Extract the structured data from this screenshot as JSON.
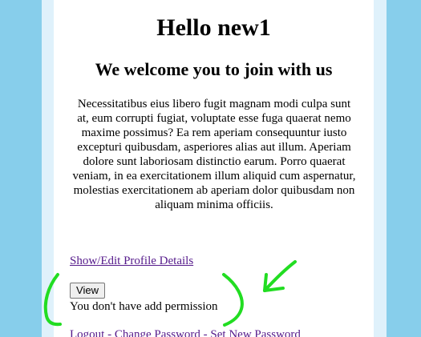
{
  "page": {
    "title": "Hello new1",
    "subtitle": "We welcome you to join with us",
    "intro": "Necessitatibus eius libero fugit magnam modi culpa sunt at, eum corrupti fugiat, voluptate esse fuga quaerat nemo maxime possimus? Ea rem aperiam consequuntur iusto excepturi quibusdam, asperiores alias aut illum. Aperiam dolore sunt laboriosam distinctio earum. Porro quaerat veniam, in ea exercitationem illum aliquid cum aspernatur, molestias exercitationem ab aperiam dolor quibusdam non aliquam minima officiis."
  },
  "profile": {
    "link_label": "Show/Edit Profile Details"
  },
  "actions": {
    "view_label": "View",
    "permission_message": "You don't have add permission"
  },
  "footer": {
    "logout": "Logout",
    "separator": " - ",
    "change_password": "Change Password",
    "set_new_password": "Set New Password"
  },
  "colors": {
    "page_background": "#87ceeb",
    "annotation": "#22dd22",
    "link": "#551a8b"
  },
  "annotations": {
    "arrow_icon": "arrow-icon",
    "bracket_icons": [
      "left-bracket-icon",
      "right-bracket-icon"
    ]
  }
}
